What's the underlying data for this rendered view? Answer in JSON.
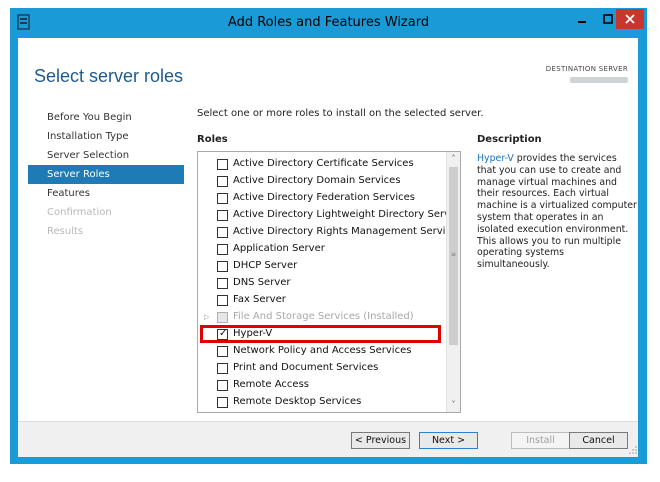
{
  "window": {
    "title": "Add Roles and Features Wizard",
    "controls": {
      "minimize": "▁",
      "maximize": "□",
      "close": "✕"
    }
  },
  "page": {
    "title": "Select server roles",
    "destination_label": "DESTINATION SERVER"
  },
  "nav": {
    "items": [
      {
        "label": "Before You Begin",
        "state": "normal"
      },
      {
        "label": "Installation Type",
        "state": "normal"
      },
      {
        "label": "Server Selection",
        "state": "normal"
      },
      {
        "label": "Server Roles",
        "state": "active"
      },
      {
        "label": "Features",
        "state": "normal"
      },
      {
        "label": "Confirmation",
        "state": "disabled"
      },
      {
        "label": "Results",
        "state": "disabled"
      }
    ]
  },
  "main": {
    "instructions": "Select one or more roles to install on the selected server.",
    "roles_label": "Roles",
    "roles": [
      {
        "label": "Active Directory Certificate Services",
        "checked": false,
        "disabled": false
      },
      {
        "label": "Active Directory Domain Services",
        "checked": false,
        "disabled": false
      },
      {
        "label": "Active Directory Federation Services",
        "checked": false,
        "disabled": false
      },
      {
        "label": "Active Directory Lightweight Directory Services",
        "checked": false,
        "disabled": false
      },
      {
        "label": "Active Directory Rights Management Services",
        "checked": false,
        "disabled": false
      },
      {
        "label": "Application Server",
        "checked": false,
        "disabled": false
      },
      {
        "label": "DHCP Server",
        "checked": false,
        "disabled": false
      },
      {
        "label": "DNS Server",
        "checked": false,
        "disabled": false
      },
      {
        "label": "Fax Server",
        "checked": false,
        "disabled": false
      },
      {
        "label": "File And Storage Services (Installed)",
        "checked": false,
        "disabled": true,
        "expander": "▷"
      },
      {
        "label": "Hyper-V",
        "checked": true,
        "disabled": false
      },
      {
        "label": "Network Policy and Access Services",
        "checked": false,
        "disabled": false
      },
      {
        "label": "Print and Document Services",
        "checked": false,
        "disabled": false
      },
      {
        "label": "Remote Access",
        "checked": false,
        "disabled": false
      },
      {
        "label": "Remote Desktop Services",
        "checked": false,
        "disabled": false
      }
    ],
    "check_glyph": "✓",
    "scroll_up": "˄",
    "scroll_down": "˅",
    "scroll_grip": "≡"
  },
  "description": {
    "label": "Description",
    "link": "Hyper-V",
    "text": " provides the services that you can use to create and manage virtual machines and their resources. Each virtual machine is a virtualized computer system that operates in an isolated execution environment. This allows you to run multiple operating systems simultaneously."
  },
  "footer": {
    "previous": "< Previous",
    "next": "Next >",
    "install": "Install",
    "cancel": "Cancel"
  },
  "colors": {
    "frame": "#1a9bd7",
    "nav_active": "#1f7bb6",
    "title": "#1e5a8e",
    "highlight": "#e00000"
  },
  "icons": {
    "app": "server-manager-icon",
    "resize": "resize-grip-icon"
  }
}
